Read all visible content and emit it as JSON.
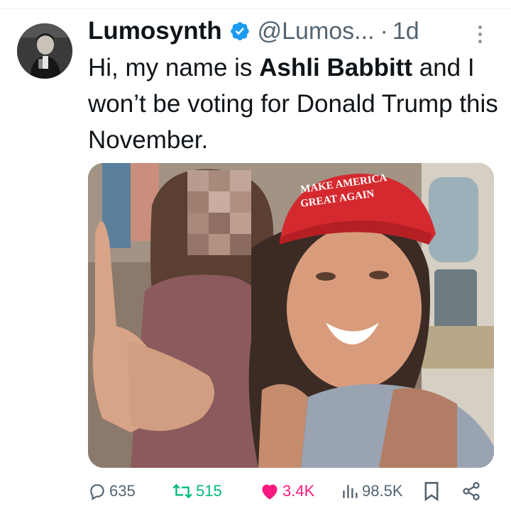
{
  "tweet": {
    "display_name": "Lumosynth",
    "handle": "@Lumos...",
    "separator": "·",
    "time": "1d",
    "text_before": "Hi, my name is ",
    "text_bold": "Ashli Babbitt",
    "text_after": " and I won’t be voting for Donald Trump this November.",
    "media": {
      "hat_text_top": "MAKE AMERICA",
      "hat_text_bottom": "GREAT AGAIN"
    }
  },
  "actions": {
    "replies": "635",
    "reposts": "515",
    "likes": "3.4K",
    "views": "98.5K"
  },
  "colors": {
    "verified": "#1d9bf0",
    "repost": "#00ba7c",
    "like": "#f91880",
    "muted": "#536471",
    "hat_red": "#d42a2f"
  },
  "icons": [
    "avatar",
    "verified-badge-icon",
    "more-icon",
    "reply-icon",
    "repost-icon",
    "like-icon",
    "views-icon",
    "bookmark-icon",
    "share-icon"
  ]
}
